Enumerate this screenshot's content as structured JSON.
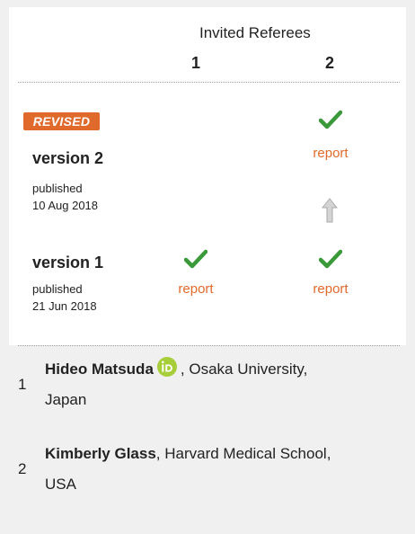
{
  "header": {
    "title": "Invited Referees",
    "columns": [
      "1",
      "2"
    ]
  },
  "versions": [
    {
      "badge": "REVISED",
      "label": "version 2",
      "published_label": "published",
      "date": "10 Aug 2018",
      "referee1": null,
      "referee2": {
        "status": "approved",
        "link": "report"
      }
    },
    {
      "label": "version 1",
      "published_label": "published",
      "date": "21 Jun 2018",
      "referee1": {
        "status": "approved",
        "link": "report"
      },
      "referee2": {
        "status": "approved",
        "link": "report"
      }
    }
  ],
  "referees": [
    {
      "number": "1",
      "name": "Hideo Matsuda",
      "affiliation_line1": ", Osaka University,",
      "affiliation_line2": "Japan",
      "orcid": true
    },
    {
      "number": "2",
      "name": "Kimberly Glass",
      "affiliation_line1": ", Harvard Medical School,",
      "affiliation_line2": "USA",
      "orcid": false
    }
  ],
  "colors": {
    "accent": "#e06a2b",
    "check": "#3a9a3a",
    "orcid": "#a6ce39",
    "arrow": "#bdbdbd"
  }
}
